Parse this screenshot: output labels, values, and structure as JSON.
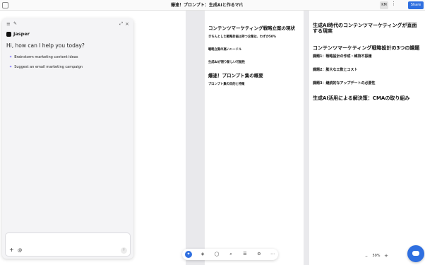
{
  "topbar": {
    "title": "爆速！プロンプト：生成AIと作るマ…",
    "avatar": "KM",
    "share_label": "Share"
  },
  "chat": {
    "brand": "Jasper",
    "greeting": "Hi, how can I help you today?",
    "suggestions": [
      {
        "label": "Brainstorm marketing content ideas"
      },
      {
        "label": "Suggest an email marketing campaign"
      }
    ],
    "input_placeholder": ""
  },
  "doc": {
    "left_heading_1": "コンテンツマーケティング戦略立案の現状",
    "left_heading_2": "きちんとした戦略計画は持つ企業は、わずか50%",
    "left_heading_3": "戦略立案の高いハードル",
    "left_heading_4": "生成AIが限り新しい可能性",
    "left_heading_5": "爆速！プロンプト集の概要",
    "left_heading_6": "プロンプト集の目的と特徴",
    "right_heading_1": "生成AI時代のコンテンツマーケティングが直面する現実",
    "right_heading_2": "コンテンツマーケティング戦略設計の3つの課題",
    "right_heading_3": "課題1：戦略設計の作成・維持不振嫌",
    "right_heading_4": "課題2：膨大な工数とコスト",
    "right_heading_5": "課題3：継続的なアップデートの必要性",
    "right_heading_6": "生成AI活用による解決策：CMAの取り組み"
  },
  "zoom": {
    "value": "59%"
  }
}
